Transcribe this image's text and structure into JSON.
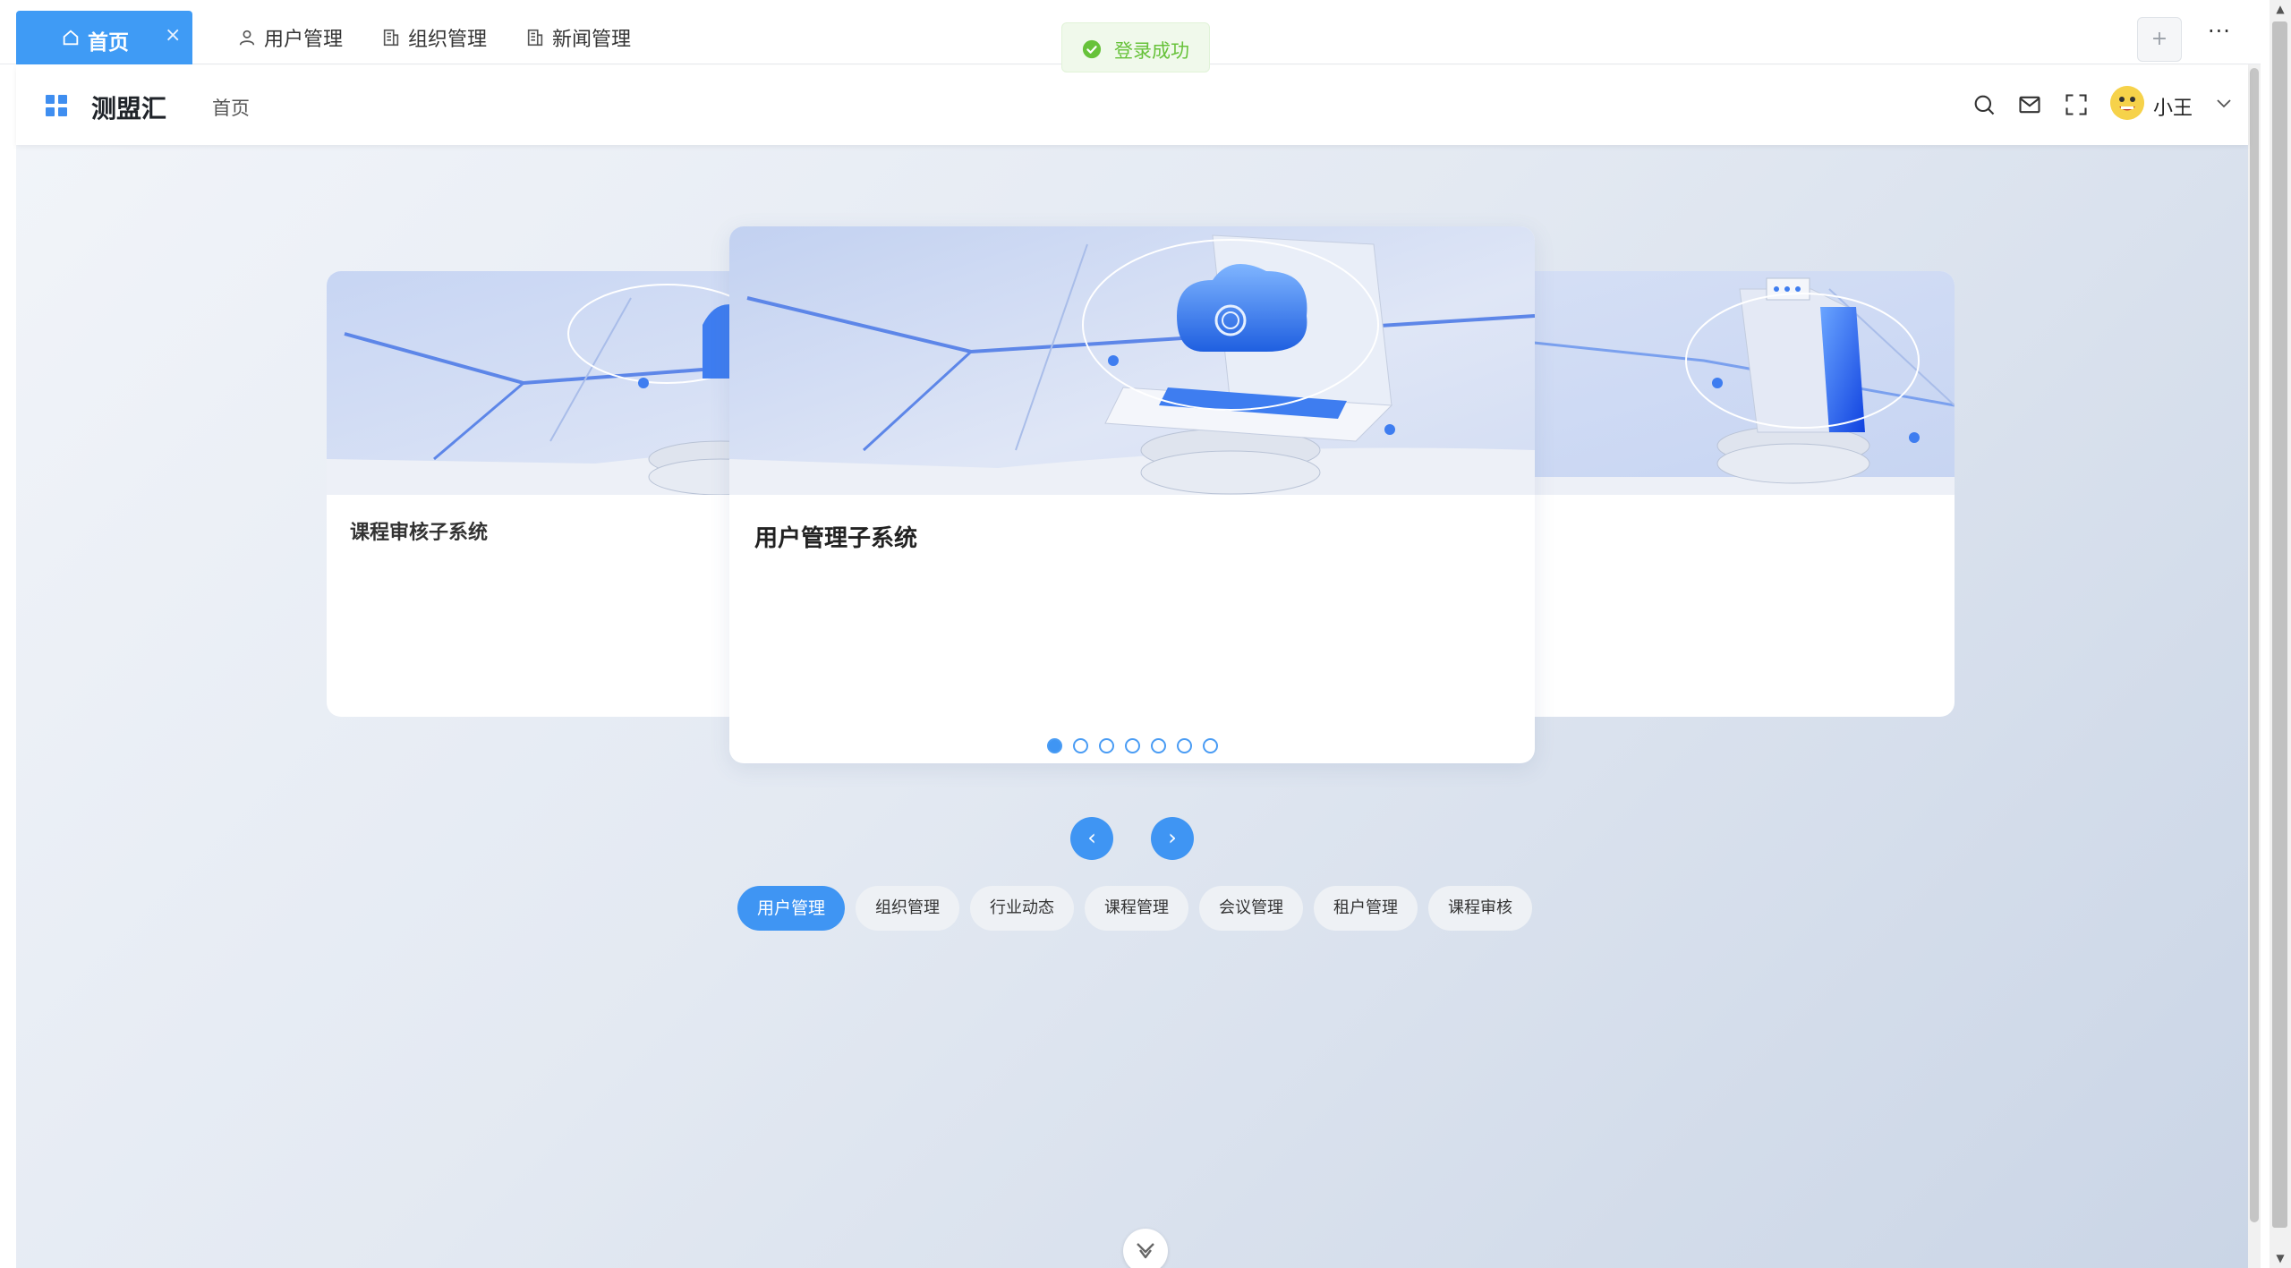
{
  "tabs": {
    "home": {
      "label": "首页",
      "close": "×"
    },
    "items": [
      {
        "label": "用户管理",
        "icon": "user-icon"
      },
      {
        "label": "组织管理",
        "icon": "building-icon"
      },
      {
        "label": "新闻管理",
        "icon": "building-icon"
      }
    ],
    "add": "+",
    "more": "···"
  },
  "toast": {
    "text": "登录成功",
    "icon": "check-circle-icon",
    "color": "#67c23a"
  },
  "header": {
    "brand": "测盟汇",
    "breadcrumb": "首页",
    "icons": [
      "search-icon",
      "mail-icon",
      "fullscreen-icon"
    ],
    "user": {
      "name": "小王",
      "avatar": "avatar"
    }
  },
  "carousel": {
    "cards": [
      {
        "title": "课程审核子系统",
        "position": "left"
      },
      {
        "title": "用户管理子系统",
        "position": "center"
      },
      {
        "title": "",
        "position": "right"
      }
    ],
    "dot_count": 7,
    "active_dot": 1,
    "prev": "‹",
    "next": "›"
  },
  "chips": [
    {
      "label": "用户管理",
      "active": true
    },
    {
      "label": "组织管理",
      "active": false
    },
    {
      "label": "行业动态",
      "active": false
    },
    {
      "label": "课程管理",
      "active": false
    },
    {
      "label": "会议管理",
      "active": false
    },
    {
      "label": "租户管理",
      "active": false
    },
    {
      "label": "课程审核",
      "active": false
    }
  ],
  "colors": {
    "primary": "#3f95f3",
    "tab_active": "#3f9bf5",
    "success": "#67c23a"
  }
}
